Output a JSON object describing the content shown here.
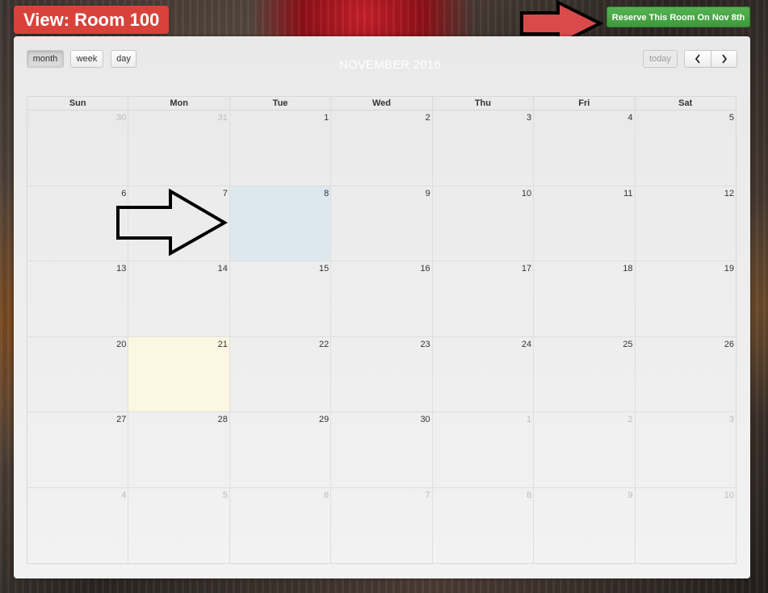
{
  "room_title": "View: Room 100",
  "reserve_button": "Reserve This Room On Nov 8th",
  "view_buttons": {
    "month": "month",
    "week": "week",
    "day": "day"
  },
  "today_button": "today",
  "prev_icon": "chevron-left-icon",
  "next_icon": "chevron-right-icon",
  "calendar_title": "NOVEMBER 2016",
  "weekdays": [
    "Sun",
    "Mon",
    "Tue",
    "Wed",
    "Thu",
    "Fri",
    "Sat"
  ],
  "weeks": [
    [
      {
        "d": "30",
        "other": true
      },
      {
        "d": "31",
        "other": true
      },
      {
        "d": "1"
      },
      {
        "d": "2"
      },
      {
        "d": "3"
      },
      {
        "d": "4"
      },
      {
        "d": "5"
      }
    ],
    [
      {
        "d": "6"
      },
      {
        "d": "7"
      },
      {
        "d": "8",
        "selected": true
      },
      {
        "d": "9"
      },
      {
        "d": "10"
      },
      {
        "d": "11"
      },
      {
        "d": "12"
      }
    ],
    [
      {
        "d": "13"
      },
      {
        "d": "14"
      },
      {
        "d": "15"
      },
      {
        "d": "16"
      },
      {
        "d": "17"
      },
      {
        "d": "18"
      },
      {
        "d": "19"
      }
    ],
    [
      {
        "d": "20"
      },
      {
        "d": "21",
        "today": true
      },
      {
        "d": "22"
      },
      {
        "d": "23"
      },
      {
        "d": "24"
      },
      {
        "d": "25"
      },
      {
        "d": "26"
      }
    ],
    [
      {
        "d": "27"
      },
      {
        "d": "28"
      },
      {
        "d": "29"
      },
      {
        "d": "30"
      },
      {
        "d": "1",
        "other": true
      },
      {
        "d": "2",
        "other": true
      },
      {
        "d": "3",
        "other": true
      }
    ],
    [
      {
        "d": "4",
        "other": true
      },
      {
        "d": "5",
        "other": true
      },
      {
        "d": "6",
        "other": true
      },
      {
        "d": "7",
        "other": true
      },
      {
        "d": "8",
        "other": true
      },
      {
        "d": "9",
        "other": true
      },
      {
        "d": "10",
        "other": true
      }
    ]
  ],
  "colors": {
    "title_badge": "#d9423b",
    "reserve_green": "#4cab48",
    "selected_day": "#dde8ee",
    "today_day": "#fcf7e3",
    "arrow_red": "#d94b4b"
  },
  "annotations": [
    "arrow-icon pointing to reserve button",
    "arrow-icon pointing to Nov 8"
  ]
}
